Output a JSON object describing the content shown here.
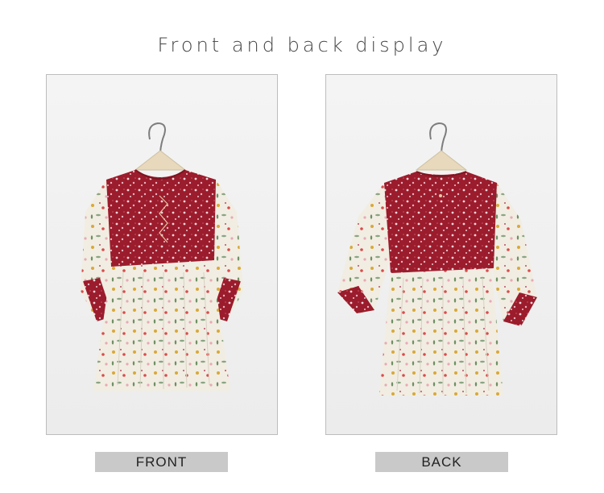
{
  "header": {
    "title": "Front and back display"
  },
  "panels": [
    {
      "caption": "FRONT",
      "image": "floral-blouse-front",
      "colors": {
        "yoke": "#9b1c2c",
        "body": "#f1ede2"
      }
    },
    {
      "caption": "BACK",
      "image": "floral-blouse-back",
      "colors": {
        "yoke": "#9b1c2c",
        "body": "#f1ede2"
      }
    }
  ]
}
